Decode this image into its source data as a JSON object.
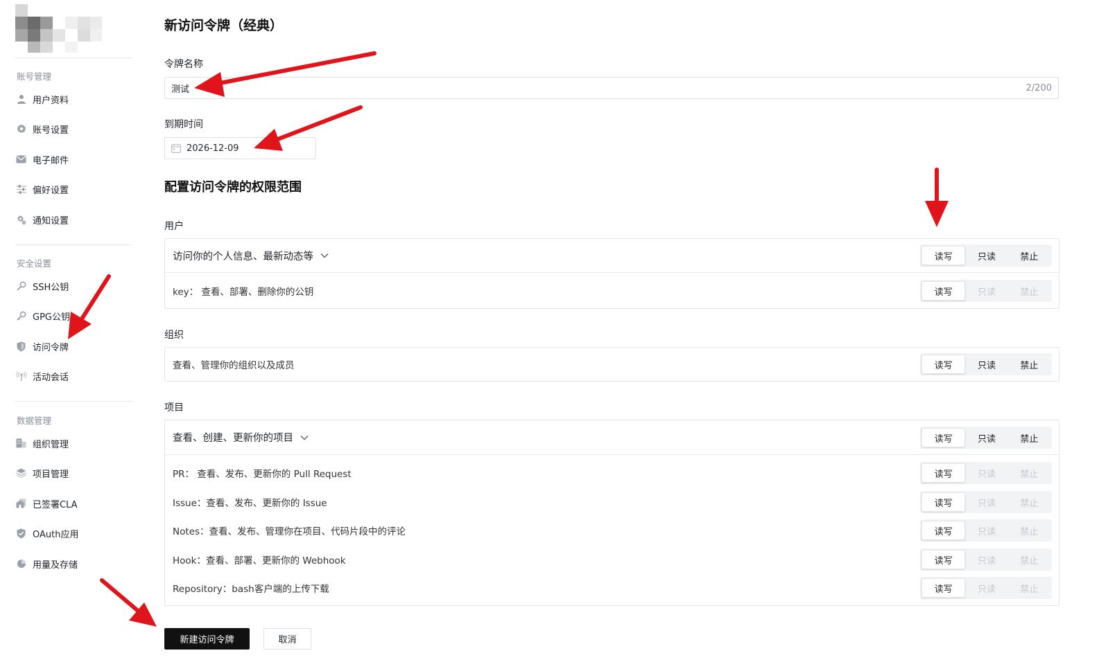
{
  "sidebar": {
    "sections": [
      {
        "title": "账号管理",
        "items": [
          "用户资料",
          "账号设置",
          "电子邮件",
          "偏好设置",
          "通知设置"
        ]
      },
      {
        "title": "安全设置",
        "items": [
          "SSH公钥",
          "GPG公钥",
          "访问令牌",
          "活动会话"
        ]
      },
      {
        "title": "数据管理",
        "items": [
          "组织管理",
          "项目管理",
          "已签署CLA",
          "OAuth应用",
          "用量及存储"
        ]
      }
    ],
    "icons": [
      "user-icon",
      "gear-icon",
      "mail-icon",
      "sliders-icon",
      "bell-gear-icon",
      "key-icon",
      "key-icon",
      "shield-icon",
      "broadcast-icon",
      "building-icon",
      "layers-icon",
      "document-icon",
      "shield-check-icon",
      "pie-icon"
    ]
  },
  "page": {
    "title": "新访问令牌（经典）",
    "name_label": "令牌名称",
    "name_value": "测试",
    "name_counter": "2/200",
    "expire_label": "到期时间",
    "expire_value": "2026-12-09",
    "scope_title": "配置访问令牌的权限范围"
  },
  "options": {
    "rw": "读写",
    "ro": "只读",
    "deny": "禁止"
  },
  "groups": {
    "user": {
      "label": "用户",
      "head": "访问你的个人信息、最新动态等",
      "rows": [
        "key：  查看、部署、删除你的公钥"
      ]
    },
    "org": {
      "label": "组织",
      "head": "查看、管理你的组织以及成员"
    },
    "project": {
      "label": "项目",
      "head": "查看、创建、更新你的项目",
      "rows": [
        "PR：  查看、发布、更新你的 Pull Request",
        "Issue：查看、发布、更新你的 Issue",
        "Notes：查看、发布、管理你在项目、代码片段中的评论",
        "Hook：查看、部署、更新你的 Webhook",
        "Repository：bash客户端的上传下载"
      ]
    }
  },
  "actions": {
    "create": "新建访问令牌",
    "cancel": "取消"
  },
  "colors": {
    "annotation_arrow": "#e0141b",
    "primary_button": "#111111"
  }
}
